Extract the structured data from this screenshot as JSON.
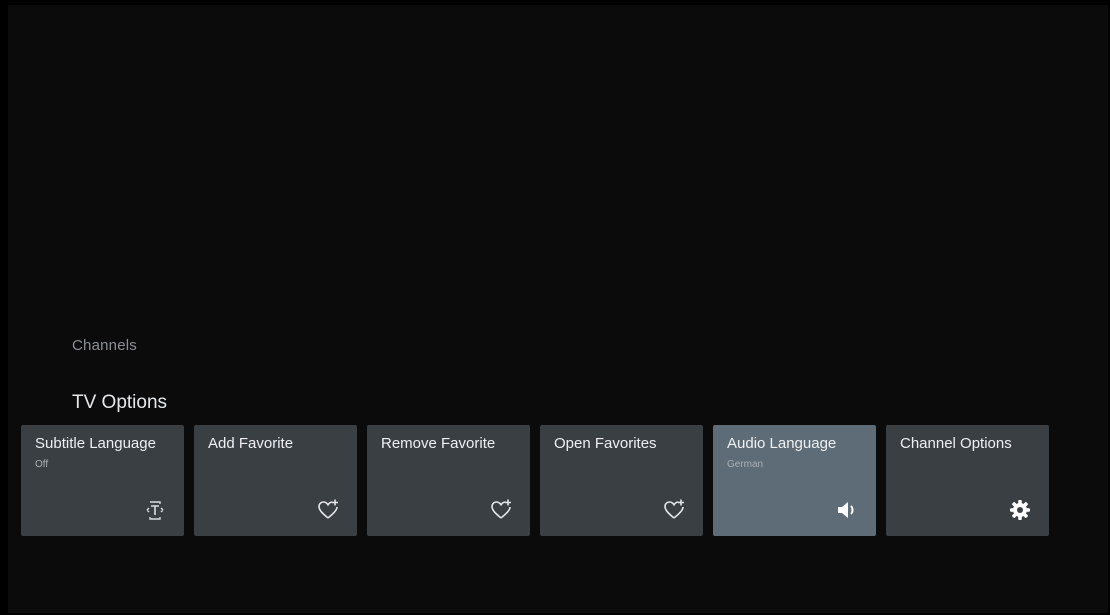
{
  "rows": {
    "channels_label": "Channels",
    "tv_options_label": "TV Options"
  },
  "cards": [
    {
      "title": "Subtitle Language",
      "subtitle": "Off",
      "icon": "subtitle-icon"
    },
    {
      "title": "Add Favorite",
      "subtitle": "",
      "icon": "heart-plus-icon"
    },
    {
      "title": "Remove Favorite",
      "subtitle": "",
      "icon": "heart-plus-icon"
    },
    {
      "title": "Open Favorites",
      "subtitle": "",
      "icon": "heart-plus-icon"
    },
    {
      "title": "Audio Language",
      "subtitle": "German",
      "icon": "speaker-icon",
      "focused": true
    },
    {
      "title": "Channel Options",
      "subtitle": "",
      "icon": "gear-icon"
    }
  ],
  "colors": {
    "card_bg": "#3a3f44",
    "card_focused_bg": "#5d6c76",
    "background": "#0b0b0c"
  }
}
